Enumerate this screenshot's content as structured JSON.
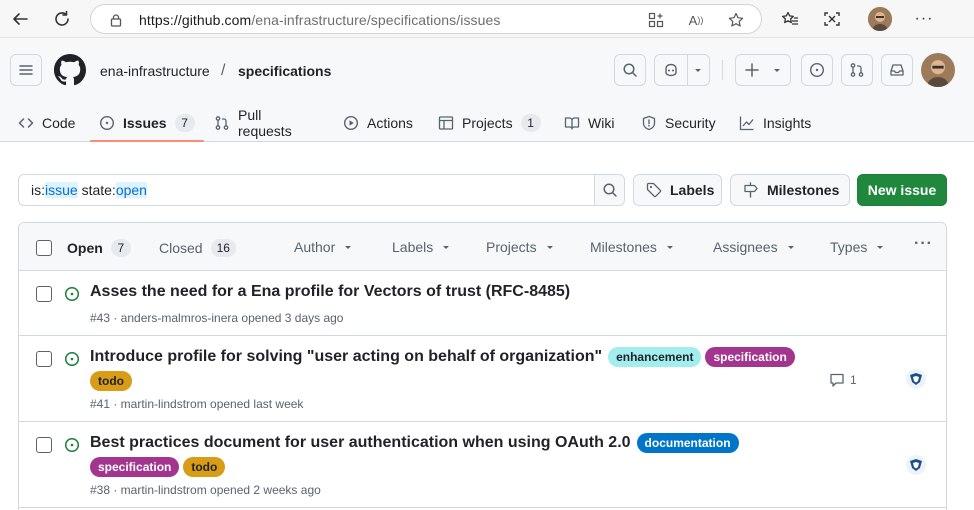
{
  "browser": {
    "url_host": "https://github.com",
    "url_path": "/ena-infrastructure/specifications/issues"
  },
  "repo": {
    "owner": "ena-infrastructure",
    "separator": "/",
    "name": "specifications"
  },
  "tabs": [
    {
      "label": "Code",
      "icon": "code-icon"
    },
    {
      "label": "Issues",
      "icon": "issue-opened-icon",
      "count": "7"
    },
    {
      "label": "Pull requests",
      "icon": "git-pull-request-icon"
    },
    {
      "label": "Actions",
      "icon": "play-icon"
    },
    {
      "label": "Projects",
      "icon": "table-icon",
      "count": "1"
    },
    {
      "label": "Wiki",
      "icon": "book-icon"
    },
    {
      "label": "Security",
      "icon": "shield-icon"
    },
    {
      "label": "Insights",
      "icon": "graph-icon"
    }
  ],
  "search": {
    "qualifier1_key": "is:",
    "qualifier1_val": "issue",
    "qualifier2_key": " state:",
    "qualifier2_val": "open"
  },
  "toolbar": {
    "labels": "Labels",
    "milestones": "Milestones",
    "new_issue": "New issue"
  },
  "list_header": {
    "open_label": "Open",
    "open_count": "7",
    "closed_label": "Closed",
    "closed_count": "16",
    "filters": [
      "Author",
      "Labels",
      "Projects",
      "Milestones",
      "Assignees",
      "Types"
    ],
    "more": "···"
  },
  "issues": [
    {
      "title": "Asses the need for a Ena profile for Vectors of trust (RFC-8485)",
      "meta": "#43 · anders-malmros-inera opened 3 days ago",
      "labels": []
    },
    {
      "title": "Introduce profile for solving \"user acting on behalf of organization\"",
      "meta": "#41 · martin-lindstrom opened last week",
      "inline_labels": [
        {
          "name": "enhancement",
          "bg": "#a2eeef",
          "fg": "#1f2328"
        },
        {
          "name": "specification",
          "bg": "#a4358f",
          "fg": "#ffffff"
        }
      ],
      "second_line_labels": [
        {
          "name": "todo",
          "bg": "#d99c16",
          "fg": "#1f2328"
        }
      ],
      "comments": "1"
    },
    {
      "title": "Best practices document for user authentication when using OAuth 2.0",
      "meta": "#38 · martin-lindstrom opened 2 weeks ago",
      "inline_labels": [
        {
          "name": "documentation",
          "bg": "#0075ca",
          "fg": "#ffffff"
        }
      ],
      "second_line_labels": [
        {
          "name": "specification",
          "bg": "#a4358f",
          "fg": "#ffffff"
        },
        {
          "name": "todo",
          "bg": "#d99c16",
          "fg": "#1f2328"
        }
      ]
    }
  ],
  "colors": {
    "open_issue": "#1a7f37",
    "primary_button": "#1f883d",
    "active_tab_underline": "#fd8c73",
    "link_highlight": "#0969da"
  }
}
